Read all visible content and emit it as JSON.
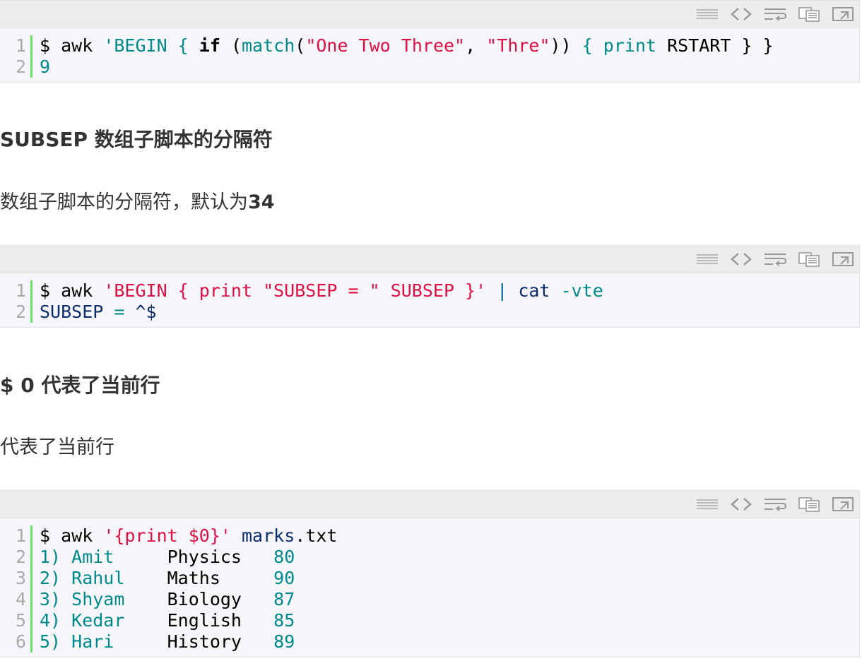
{
  "blocks": [
    {
      "lines": [
        {
          "n": "1",
          "tokens": [
            [
              "pl",
              "$ awk "
            ],
            [
              "tea",
              "'BEGIN { "
            ],
            [
              "bold",
              "if"
            ],
            [
              "pl",
              " ("
            ],
            [
              "tea",
              "match"
            ],
            [
              "pl",
              "("
            ],
            [
              "str",
              "\"One Two Three\""
            ],
            [
              "pl",
              ", "
            ],
            [
              "str",
              "\"Thre\""
            ],
            [
              "pl",
              ")) "
            ],
            [
              "tea",
              "{ print"
            ],
            [
              "pl",
              " RSTART } }"
            ]
          ]
        },
        {
          "n": "2",
          "tokens": [
            [
              "tea",
              "9"
            ]
          ]
        }
      ]
    },
    {
      "lines": [
        {
          "n": "1",
          "tokens": [
            [
              "pl",
              "$ awk "
            ],
            [
              "str",
              "'BEGIN { print \"SUBSEP = \" SUBSEP }'"
            ],
            [
              "pl",
              " "
            ],
            [
              "kw",
              "|"
            ],
            [
              "pl",
              " "
            ],
            [
              "nav",
              "cat"
            ],
            [
              "pl",
              " "
            ],
            [
              "tea",
              "-vte"
            ]
          ]
        },
        {
          "n": "2",
          "tokens": [
            [
              "nav",
              "SUBSEP"
            ],
            [
              "pl",
              " "
            ],
            [
              "tea",
              "="
            ],
            [
              "pl",
              " "
            ],
            [
              "nav",
              "^$"
            ]
          ]
        }
      ]
    },
    {
      "lines": [
        {
          "n": "1",
          "tokens": [
            [
              "pl",
              "$ awk "
            ],
            [
              "str",
              "'{print $0}'"
            ],
            [
              "pl",
              " "
            ],
            [
              "nav",
              "marks"
            ],
            [
              "pl",
              ".txt"
            ]
          ]
        },
        {
          "n": "2",
          "tokens": [
            [
              "tea",
              "1) Amit"
            ],
            [
              "pl",
              "     Physics   "
            ],
            [
              "tea",
              "80"
            ]
          ]
        },
        {
          "n": "3",
          "tokens": [
            [
              "tea",
              "2) Rahul"
            ],
            [
              "pl",
              "    Maths     "
            ],
            [
              "tea",
              "90"
            ]
          ]
        },
        {
          "n": "4",
          "tokens": [
            [
              "tea",
              "3) Shyam"
            ],
            [
              "pl",
              "    Biology   "
            ],
            [
              "tea",
              "87"
            ]
          ]
        },
        {
          "n": "5",
          "tokens": [
            [
              "tea",
              "4) Kedar"
            ],
            [
              "pl",
              "    English   "
            ],
            [
              "tea",
              "85"
            ]
          ]
        },
        {
          "n": "6",
          "tokens": [
            [
              "tea",
              "5) Hari"
            ],
            [
              "pl",
              "     History   "
            ],
            [
              "tea",
              "89"
            ]
          ]
        }
      ]
    }
  ],
  "sections": [
    {
      "heading": "SUBSEP 数组子脚本的分隔符",
      "text": "数组子脚本的分隔符，默认为",
      "text_bold": "34"
    },
    {
      "heading": "$ 0 代表了当前行",
      "text": "代表了当前行",
      "text_bold": ""
    }
  ],
  "toolbar_icons": [
    "view-plain-icon",
    "view-source-icon",
    "wrap-icon",
    "copy-icon",
    "popup-icon"
  ]
}
